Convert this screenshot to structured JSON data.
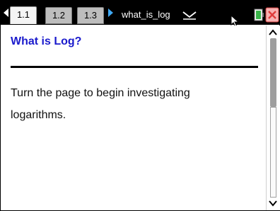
{
  "tabs": [
    {
      "label": "1.1",
      "active": true
    },
    {
      "label": "1.2",
      "active": false
    },
    {
      "label": "1.3",
      "active": false
    }
  ],
  "document": {
    "name": "what_is_log"
  },
  "page": {
    "title": "What is Log?",
    "body": "Turn the page to begin investigating logarithms."
  },
  "icons": {
    "prev": "arrow-left-icon",
    "next": "arrow-right-icon",
    "menu": "chevron-down-icon",
    "cursor": "pointer-cursor-icon",
    "battery": "battery-icon",
    "close": "close-icon"
  },
  "colors": {
    "title": "#1a1acc",
    "tabbar": "#000000",
    "next_arrow": "#3fa9f5",
    "close": "#e03c3c",
    "battery": "#3bb44a"
  }
}
